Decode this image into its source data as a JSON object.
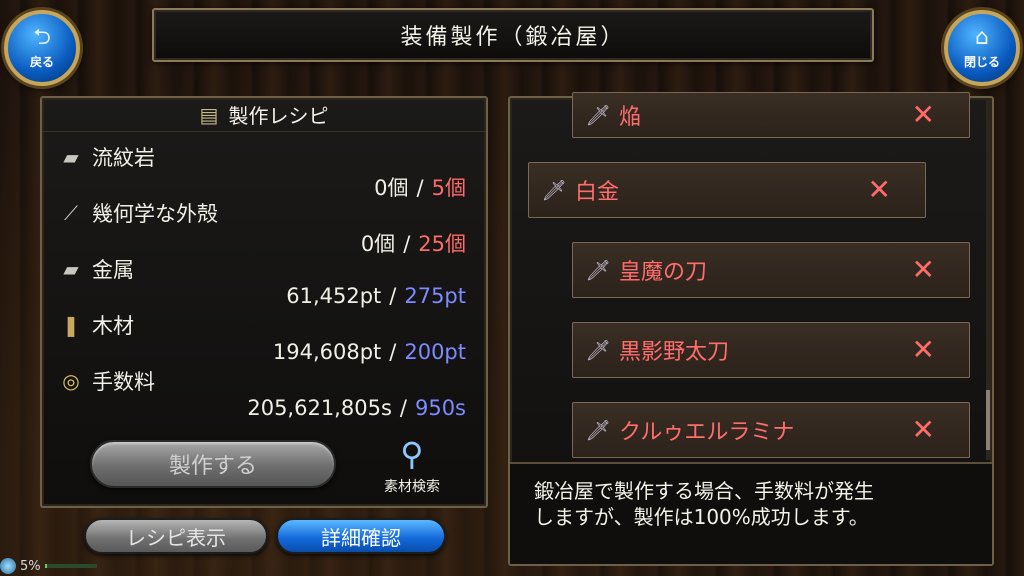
{
  "header": {
    "title": "装備製作（鍛冶屋）",
    "back_label": "戻る",
    "close_label": "閉じる"
  },
  "recipe_panel": {
    "title": "製作レシピ",
    "materials": [
      {
        "name": "流紋岩",
        "icon": "ingot-icon",
        "owned": "0個",
        "required": "5個",
        "required_color": "#ff6b6b"
      },
      {
        "name": "幾何学な外殻",
        "icon": "shell-icon",
        "owned": "0個",
        "required": "25個",
        "required_color": "#ff6b6b"
      },
      {
        "name": "金属",
        "icon": "metal-icon",
        "owned": "61,452pt",
        "required": "275pt",
        "required_color": "#7a8cff"
      },
      {
        "name": "木材",
        "icon": "wood-icon",
        "owned": "194,608pt",
        "required": "200pt",
        "required_color": "#7a8cff"
      },
      {
        "name": "手数料",
        "icon": "coin-icon",
        "owned": "205,621,805s",
        "required": "950s",
        "required_color": "#7a8cff"
      }
    ],
    "craft_button": "製作する",
    "search_button": "素材検索"
  },
  "bottom_buttons": {
    "recipe_display": "レシピ表示",
    "detail_confirm": "詳細確認"
  },
  "recipe_list": [
    {
      "name": "焔",
      "icon": "sword-icon"
    },
    {
      "name": "白金",
      "icon": "sword-icon"
    },
    {
      "name": "皇魔の刀",
      "icon": "sword-icon"
    },
    {
      "name": "黒影野太刀",
      "icon": "sword-icon"
    },
    {
      "name": "クルゥエルラミナ",
      "icon": "sword-icon"
    }
  ],
  "info_text_line1": "鍛冶屋で製作する場合、手数料が発生",
  "info_text_line2": "しますが、製作は100%成功します。",
  "status": {
    "percent_label": "5%",
    "progress": 0.05
  }
}
